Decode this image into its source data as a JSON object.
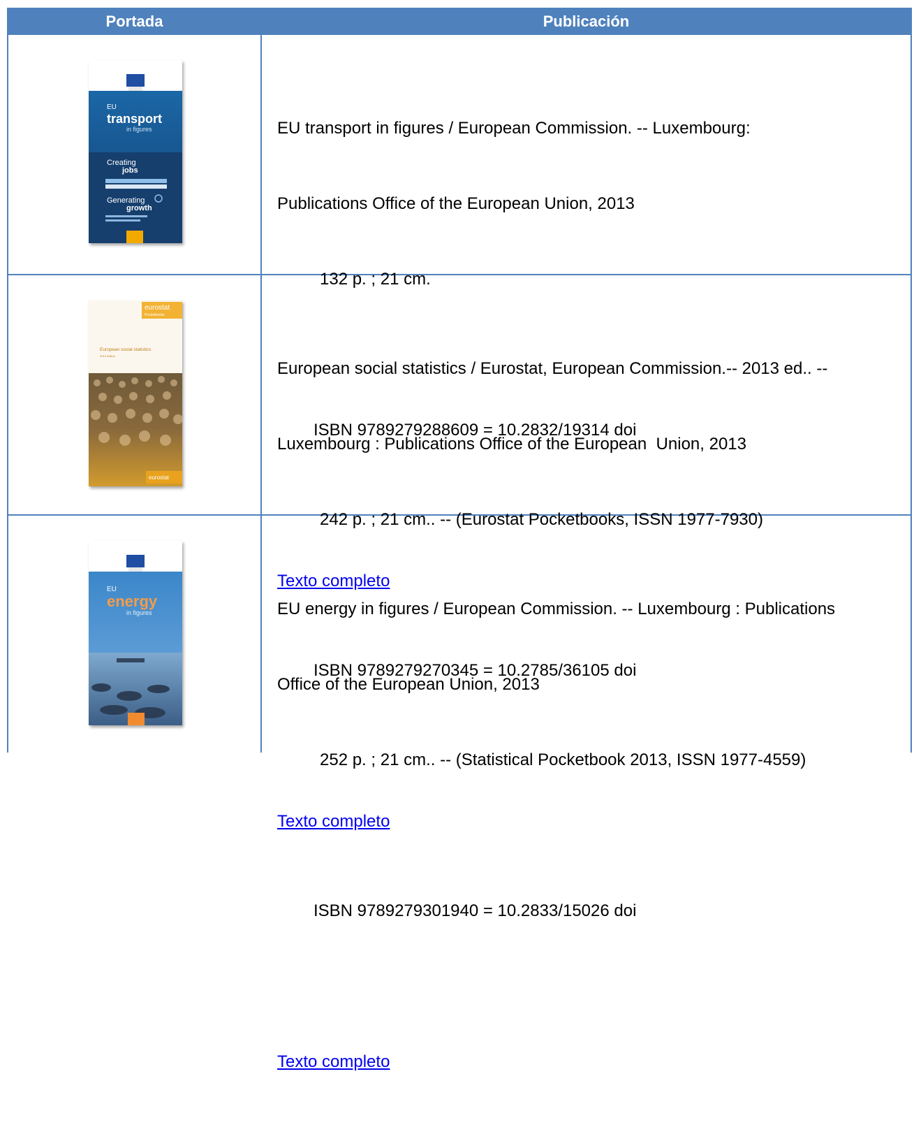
{
  "header": {
    "col_cover": "Portada",
    "col_publication": "Publicación"
  },
  "colors": {
    "header_bg": "#4f81bd",
    "link": "#0000ee"
  },
  "publications": [
    {
      "title_line1": "EU transport in figures / European Commission. -- Luxembourg:",
      "title_line2": "Publications Office of the European Union, 2013",
      "extent": "132 p. ; 21 cm.",
      "isbn": "ISBN 9789279288609 = 10.2832/19314 doi",
      "link": "Texto completo",
      "cover": {
        "eu": "EU",
        "main": "transport",
        "sub": "in figures",
        "t1": "Creating",
        "t2": "jobs",
        "t3": "Generating",
        "t4": "growth"
      }
    },
    {
      "title_line1": "European social statistics / Eurostat, European Commission.-- 2013 ed.. --",
      "title_line2": "Luxembourg : Publications Office of the European  Union, 2013",
      "extent": "242 p. ; 21 cm.. -- (Eurostat Pocketbooks, ISSN 1977-7930)",
      "isbn": "ISBN 9789279270345 = 10.2785/36105 doi",
      "link": "Texto completo",
      "cover": {
        "brand": "eurostat",
        "brand_sub": "Pocketbooks",
        "main": "European social statistics",
        "sub": "2013 edition",
        "footer": "eurostat"
      }
    },
    {
      "title_line1": "EU energy in figures / European Commission. -- Luxembourg : Publications",
      "title_line2": "Office of the European Union, 2013",
      "extent": "252 p. ; 21 cm.. -- (Statistical Pocketbook 2013, ISSN 1977-4559)",
      "isbn": "ISBN 9789279301940 = 10.2833/15026 doi",
      "link": "Texto completo",
      "cover": {
        "eu": "EU",
        "main": "energy",
        "sub": "in figures"
      }
    }
  ]
}
